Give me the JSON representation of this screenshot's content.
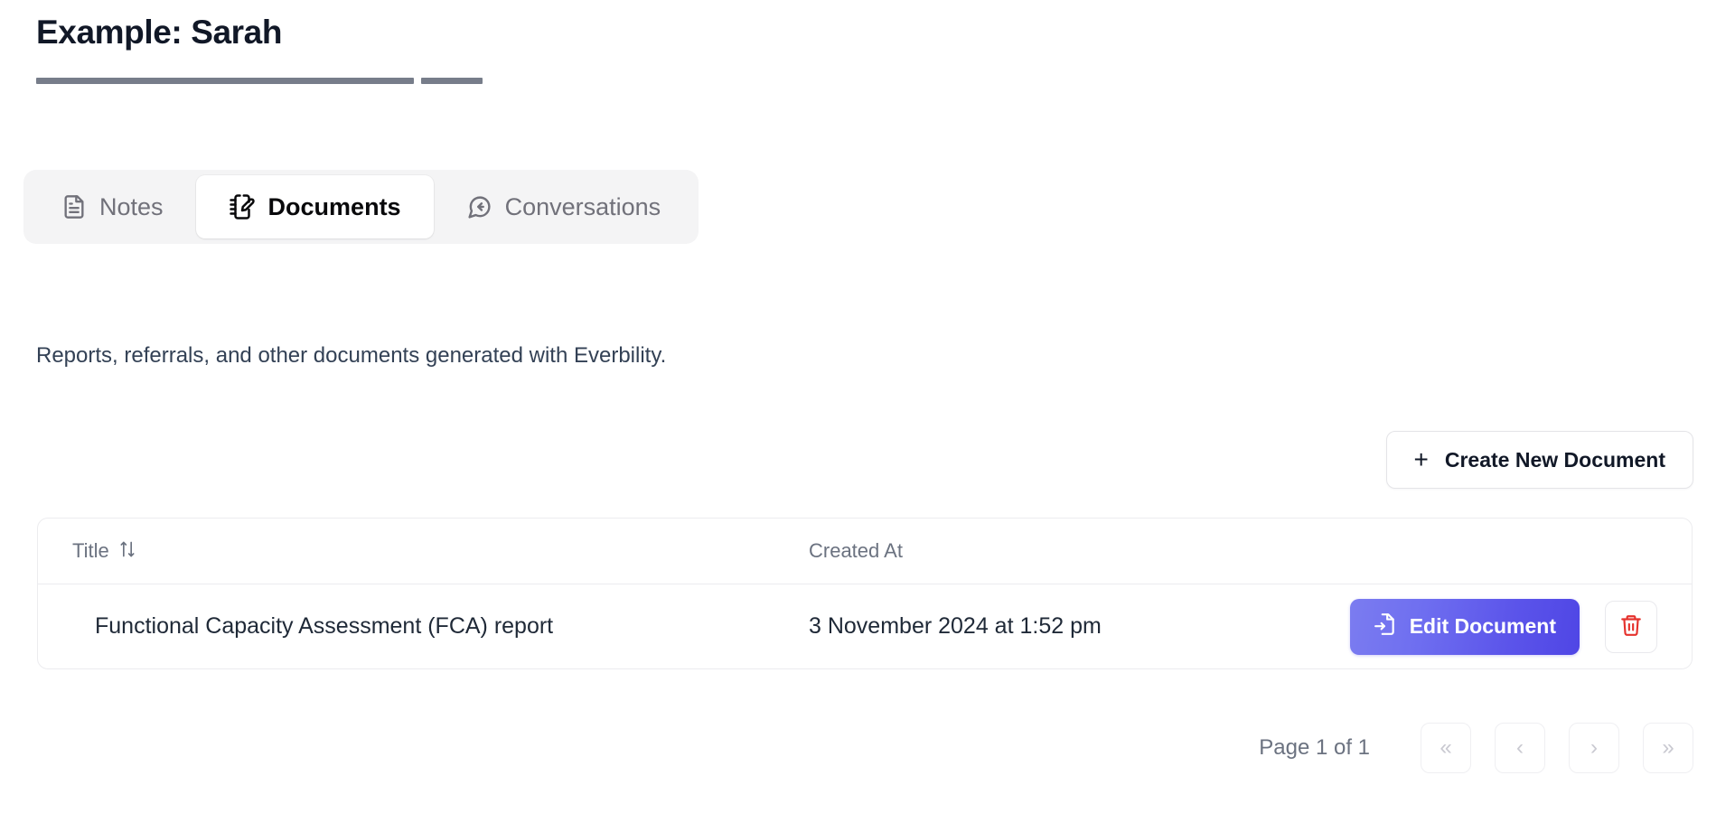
{
  "header": {
    "title": "Example: Sarah",
    "skeleton_bars": 2
  },
  "tabs": [
    {
      "label": "Notes",
      "icon": "file-text-icon",
      "active": false
    },
    {
      "label": "Documents",
      "icon": "notebook-pen-icon",
      "active": true
    },
    {
      "label": "Conversations",
      "icon": "message-reply-icon",
      "active": false
    }
  ],
  "main": {
    "description": "Reports, referrals, and other documents generated with Everbility.",
    "create_button": {
      "label": "Create New Document",
      "icon": "plus-icon"
    },
    "table": {
      "columns": [
        {
          "label": "Title",
          "sortable": true,
          "sort_icon": "sort-updown-icon"
        },
        {
          "label": "Created At",
          "sortable": false
        }
      ],
      "rows": [
        {
          "title": "Functional Capacity Assessment (FCA) report",
          "created_at": "3 November 2024 at 1:52 pm",
          "edit_label": "Edit Document",
          "edit_icon": "file-input-icon",
          "delete_icon": "trash-icon"
        }
      ]
    },
    "pagination": {
      "info": "Page 1 of 1",
      "buttons": [
        {
          "label": "«",
          "name": "first-page-button"
        },
        {
          "label": "‹",
          "name": "prev-page-button"
        },
        {
          "label": "›",
          "name": "next-page-button"
        },
        {
          "label": "»",
          "name": "last-page-button"
        }
      ]
    }
  },
  "colors": {
    "accent_start": "#7b7cf0",
    "accent_end": "#4f46e5",
    "danger": "#e5322d",
    "text_primary": "#111827",
    "text_muted": "#6b7280",
    "tabbar_bg": "#f4f4f5"
  }
}
